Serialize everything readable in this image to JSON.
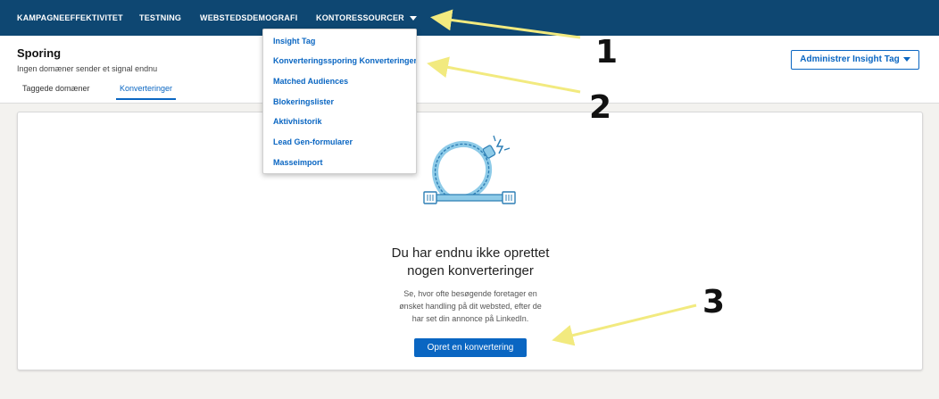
{
  "nav": {
    "items": [
      "KAMPAGNEEFFEKTIVITET",
      "TESTNING",
      "WEBSTEDSDEMOGRAFI",
      "KONTORESSOURCER"
    ]
  },
  "header": {
    "title": "Sporing",
    "subtitle": "Ingen domæner sender et signal endnu",
    "tabs": [
      "Taggede domæner",
      "Konverteringer"
    ],
    "active_tab": "Konverteringer",
    "manage_button": "Administrer Insight Tag"
  },
  "dropdown": {
    "items": [
      "Insight Tag",
      "Konverteringssporing Konverteringer",
      "Matched Audiences",
      "Blokeringslister",
      "Aktivhistorik",
      "Lead Gen-formularer",
      "Masseimport"
    ]
  },
  "empty_state": {
    "title_line1": "Du har endnu ikke oprettet",
    "title_line2": "nogen konverteringer",
    "desc_line1": "Se, hvor ofte besøgende foretager en",
    "desc_line2": "ønsket handling på dit websted, efter de",
    "desc_line3": "har set din annonce på LinkedIn.",
    "button": "Opret en konvertering"
  },
  "annotations": {
    "markers": [
      "1",
      "2",
      "3"
    ]
  },
  "colors": {
    "nav_bg": "#0e4772",
    "accent": "#0a66c2",
    "illustration": "#8ecbe8",
    "arrow": "#f2ea7f"
  },
  "icons": {
    "nav_caret": "caret-down-icon",
    "illustration": "disconnected-cable-icon"
  }
}
